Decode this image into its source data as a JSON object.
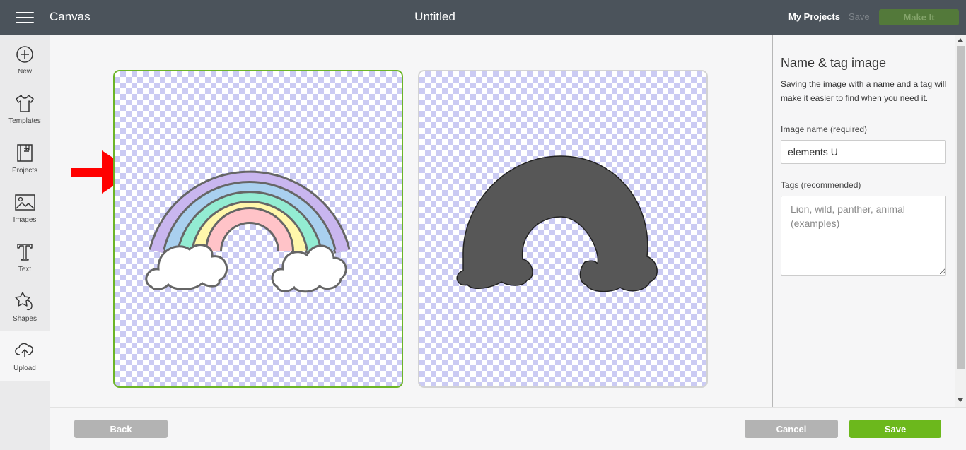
{
  "topbar": {
    "app_title": "Canvas",
    "doc_title": "Untitled",
    "my_projects": "My Projects",
    "save": "Save",
    "make_it": "Make It"
  },
  "sidebar": {
    "items": [
      {
        "label": "New",
        "icon": "plus-circle-icon"
      },
      {
        "label": "Templates",
        "icon": "tshirt-icon"
      },
      {
        "label": "Projects",
        "icon": "projects-book-icon"
      },
      {
        "label": "Images",
        "icon": "image-icon"
      },
      {
        "label": "Text",
        "icon": "text-t-icon"
      },
      {
        "label": "Shapes",
        "icon": "shapes-icon"
      },
      {
        "label": "Upload",
        "icon": "cloud-upload-icon"
      }
    ],
    "active": "Upload"
  },
  "panel": {
    "title": "Name & tag image",
    "description": "Saving the image with a name and a tag will make it easier to find when you need it.",
    "image_name_label": "Image name (required)",
    "image_name_value": "elements U",
    "tags_label": "Tags (recommended)",
    "tags_placeholder": "Lion, wild, panther, animal (examples)"
  },
  "bottombar": {
    "back": "Back",
    "cancel": "Cancel",
    "save": "Save"
  },
  "colors": {
    "topbar": "#4b535b",
    "accent_green": "#6cb81c",
    "selected_border": "#6cb527",
    "arrow_red": "#ff0000",
    "cut_silhouette": "#575757"
  }
}
